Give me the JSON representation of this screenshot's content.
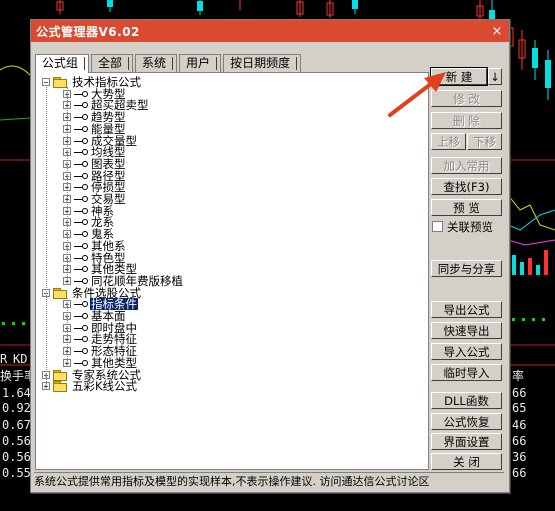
{
  "background": {
    "left_labels": [
      "R",
      "KD",
      "换手率",
      "1.64",
      "0.92",
      "0.67",
      "0.56",
      "0.56",
      "0.55"
    ],
    "right_labels": [
      "率",
      "66",
      "65",
      "46",
      "66",
      "36",
      "66"
    ]
  },
  "dialog": {
    "title": "公式管理器V6.02",
    "close_glyph": "×"
  },
  "tabs": [
    "公式组",
    "全部",
    "系统",
    "用户",
    "按日期频度"
  ],
  "tree": {
    "groups": [
      {
        "label": "技术指标公式",
        "expanded": true,
        "children": [
          "大势型",
          "超买超卖型",
          "趋势型",
          "能量型",
          "成交量型",
          "均线型",
          "图表型",
          "路径型",
          "停损型",
          "交易型",
          "神系",
          "龙系",
          "鬼系",
          "其他系",
          "特色型",
          "其他类型",
          "同花顺年费版移植"
        ]
      },
      {
        "label": "条件选股公式",
        "expanded": true,
        "children": [
          "指标条件",
          "基本面",
          "即时盘中",
          "走势特征",
          "形态特征",
          "其他类型"
        ]
      },
      {
        "label": "专家系统公式",
        "expanded": false,
        "children": []
      },
      {
        "label": "五彩K线公式",
        "expanded": false,
        "children": []
      }
    ],
    "selected": "指标条件"
  },
  "buttons": {
    "new": "新 建",
    "new_dropdown": "↓",
    "edit": "修 改",
    "delete": "删 除",
    "move_up": "上移",
    "move_down": "下移",
    "add_common": "加入常用",
    "find": "查找(F3)",
    "preview": "预 览",
    "sync_share": "同步与分享",
    "export": "导出公式",
    "quick_export": "快速导出",
    "import": "导入公式",
    "temp_import": "临时导入",
    "dll": "DLL函数",
    "restore": "公式恢复",
    "ui_settings": "界面设置",
    "close": "关 闭"
  },
  "checkbox": {
    "label": "关联预览",
    "checked": false
  },
  "status_text": "系统公式提供常用指标及模型的实现样本,不表示操作建议. 访问通达信公式讨论区",
  "colors": {
    "titlebar": "#d94a31",
    "selection": "#0a246a",
    "arrow": "#e0401a"
  }
}
